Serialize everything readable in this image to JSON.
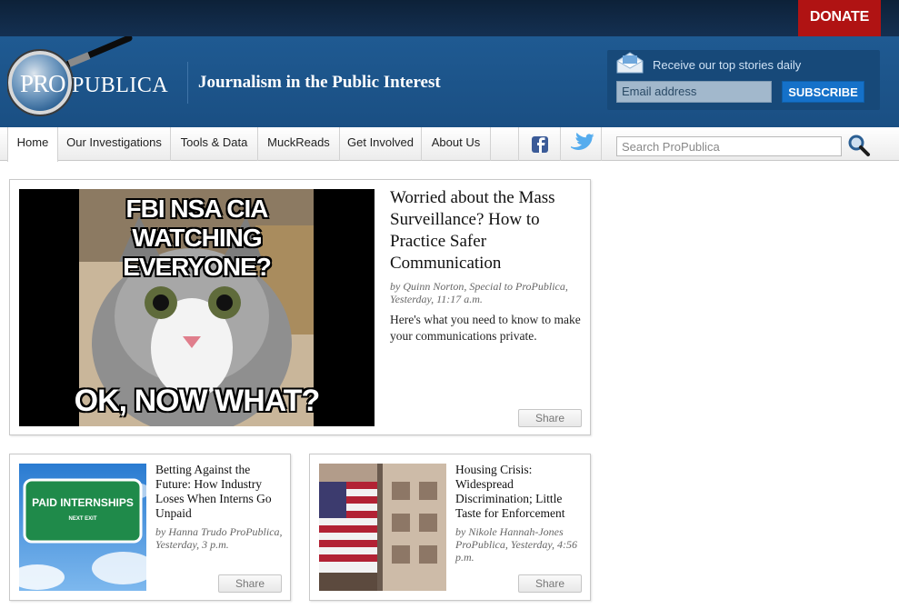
{
  "header": {
    "donate_label": "DONATE",
    "logo_text_pro": "PRO",
    "logo_text_publica": "PUBLICA",
    "tagline": "Journalism in the Public Interest",
    "newsletter": {
      "label": "Receive our top stories daily",
      "email_placeholder": "Email address",
      "subscribe_label": "SUBSCRIBE"
    }
  },
  "nav": {
    "items": [
      {
        "label": "Home",
        "active": true
      },
      {
        "label": "Our Investigations"
      },
      {
        "label": "Tools & Data"
      },
      {
        "label": "MuckReads"
      },
      {
        "label": "Get Involved"
      },
      {
        "label": "About Us"
      }
    ],
    "social": [
      "facebook-icon",
      "twitter-icon"
    ],
    "search_placeholder": "Search ProPublica"
  },
  "featured": {
    "image_caption_top": "FBI NSA CIA WATCHING EVERYONE?",
    "image_caption_bottom": "OK, NOW WHAT?",
    "headline": "Worried about the Mass Surveillance? How to Practice Safer Communication",
    "byline": "by Quinn Norton, Special to ProPublica, Yesterday, 11:17 a.m.",
    "summary": "Here's what you need to know to make your communications private.",
    "share_label": "Share"
  },
  "stories": [
    {
      "image_sign_text": "PAID INTERNSHIPS",
      "image_sign_sub": "NEXT EXIT",
      "headline": "Betting Against the Future: How Industry Loses When Interns Go Unpaid",
      "byline": "by Hanna Trudo ProPublica, Yesterday, 3 p.m.",
      "share_label": "Share"
    },
    {
      "headline": "Housing Crisis: Widespread Discrimination; Little Taste for Enforcement",
      "byline": "by Nikole Hannah-Jones ProPublica, Yesterday, 4:56 p.m.",
      "share_label": "Share"
    }
  ],
  "colors": {
    "header_blue": "#1f5a92",
    "donate_red": "#b01313",
    "subscribe_blue": "#1571c9"
  }
}
